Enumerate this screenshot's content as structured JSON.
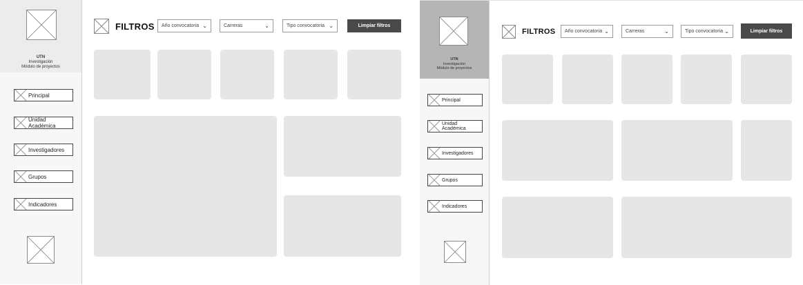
{
  "frames": [
    {
      "brand": {
        "line1": "UTN",
        "line2": "Investigación",
        "line3": "Módulo de proyectos"
      },
      "nav": [
        {
          "label": "Principal"
        },
        {
          "label": "Unidad Académica"
        },
        {
          "label": "Investigadores"
        },
        {
          "label": "Grupos"
        },
        {
          "label": "Indicadores"
        }
      ],
      "filters": {
        "title": "FILTROS",
        "year_select": "Año convocatoria",
        "career_select": "Carreras",
        "type_select": "Tipo convocatoria",
        "clear_button": "Limpiar filtros"
      }
    },
    {
      "brand": {
        "line1": "UTN",
        "line2": "Investigación",
        "line3": "Módulo de proyectos"
      },
      "nav": [
        {
          "label": "Principal"
        },
        {
          "label": "Unidad Académica"
        },
        {
          "label": "Investigadores"
        },
        {
          "label": "Grupos"
        },
        {
          "label": "Indicadores"
        }
      ],
      "filters": {
        "title": "FILTROS",
        "year_select": "Año convocatoria",
        "career_select": "Carreras",
        "type_select": "Tipo convocatoria",
        "clear_button": "Limpiar filtros"
      }
    }
  ],
  "icons": {
    "placeholder": "image-placeholder-icon",
    "dropdown": "chevron-down-icon"
  },
  "colors": {
    "card": "#e6e6e6",
    "button": "#4a4a4a",
    "sidebar_header_right": "#b5b5b5"
  }
}
